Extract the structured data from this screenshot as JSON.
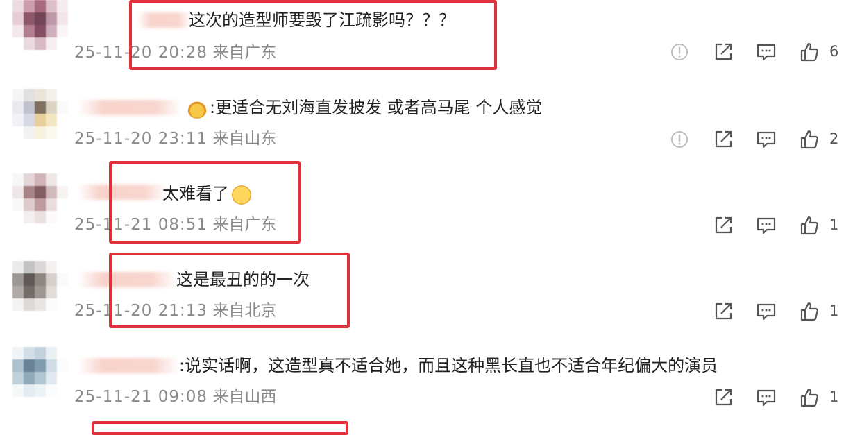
{
  "comments": [
    {
      "text": "这次的造型师要毁了江疏影吗？？？",
      "time": "25-11-20 20:28",
      "location": "来自广东",
      "likes": "6",
      "has_report": true,
      "highlighted": true,
      "emoji_after": null
    },
    {
      "text": ":更适合无刘海直发披发 或者高马尾 个人感觉",
      "time": "25-11-20 23:11",
      "location": "来自山东",
      "likes": "2",
      "has_report": true,
      "highlighted": false,
      "emoji_before": "crown-emoji"
    },
    {
      "text": "太难看了",
      "time": "25-11-21 08:51",
      "location": "来自广东",
      "likes": "1",
      "has_report": false,
      "highlighted": true,
      "emoji_after": "crying-face-emoji"
    },
    {
      "text": "这是最丑的的一次",
      "time": "25-11-20 21:13",
      "location": "来自北京",
      "likes": "1",
      "has_report": false,
      "highlighted": true
    },
    {
      "text": ":说实话啊，这造型真不适合她，而且这种黑长直也不适合年纪偏大的演员",
      "time": "25-11-21 09:08",
      "location": "来自山西",
      "likes": "1",
      "has_report": false,
      "highlighted": false
    }
  ],
  "icons": {
    "report": "report-icon",
    "share": "share-icon",
    "reply": "comment-icon",
    "like": "thumbs-up-icon"
  },
  "colors": {
    "highlight_border": "#e0303a",
    "meta_text": "#8a8a8a",
    "icon_stroke": "#555555"
  }
}
